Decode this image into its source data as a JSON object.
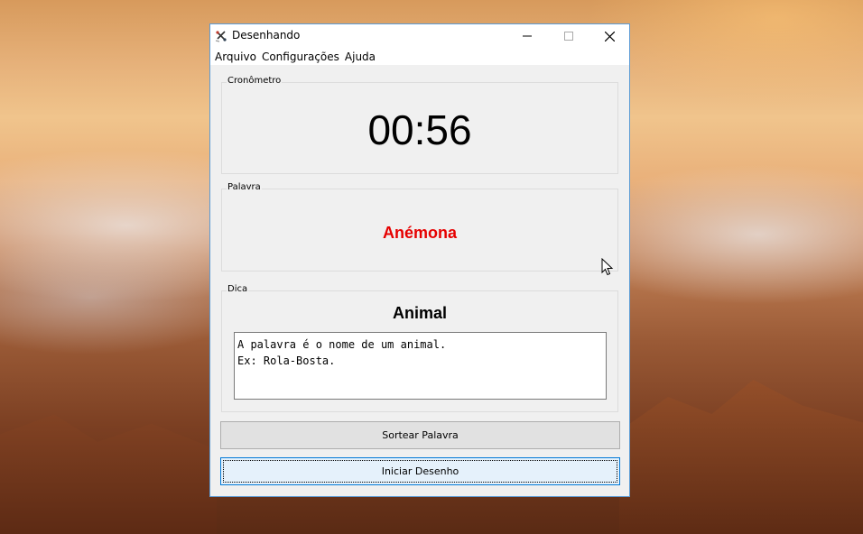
{
  "window": {
    "title": "Desenhando"
  },
  "menu": {
    "items": [
      "Arquivo",
      "Configurações",
      "Ajuda"
    ]
  },
  "stopwatch": {
    "label": "Cronômetro",
    "time": "00:56"
  },
  "word_panel": {
    "label": "Palavra",
    "word": "Anémona",
    "word_color": "#e60000"
  },
  "hint_panel": {
    "label": "Dica",
    "category": "Animal",
    "text": "A palavra é o nome de um animal.\nEx: Rola-Bosta."
  },
  "buttons": {
    "draw_word": "Sortear Palavra",
    "start_drawing": "Iniciar Desenho"
  },
  "colors": {
    "window_border": "#5b9bd5",
    "focus_button_border": "#0078d7"
  }
}
